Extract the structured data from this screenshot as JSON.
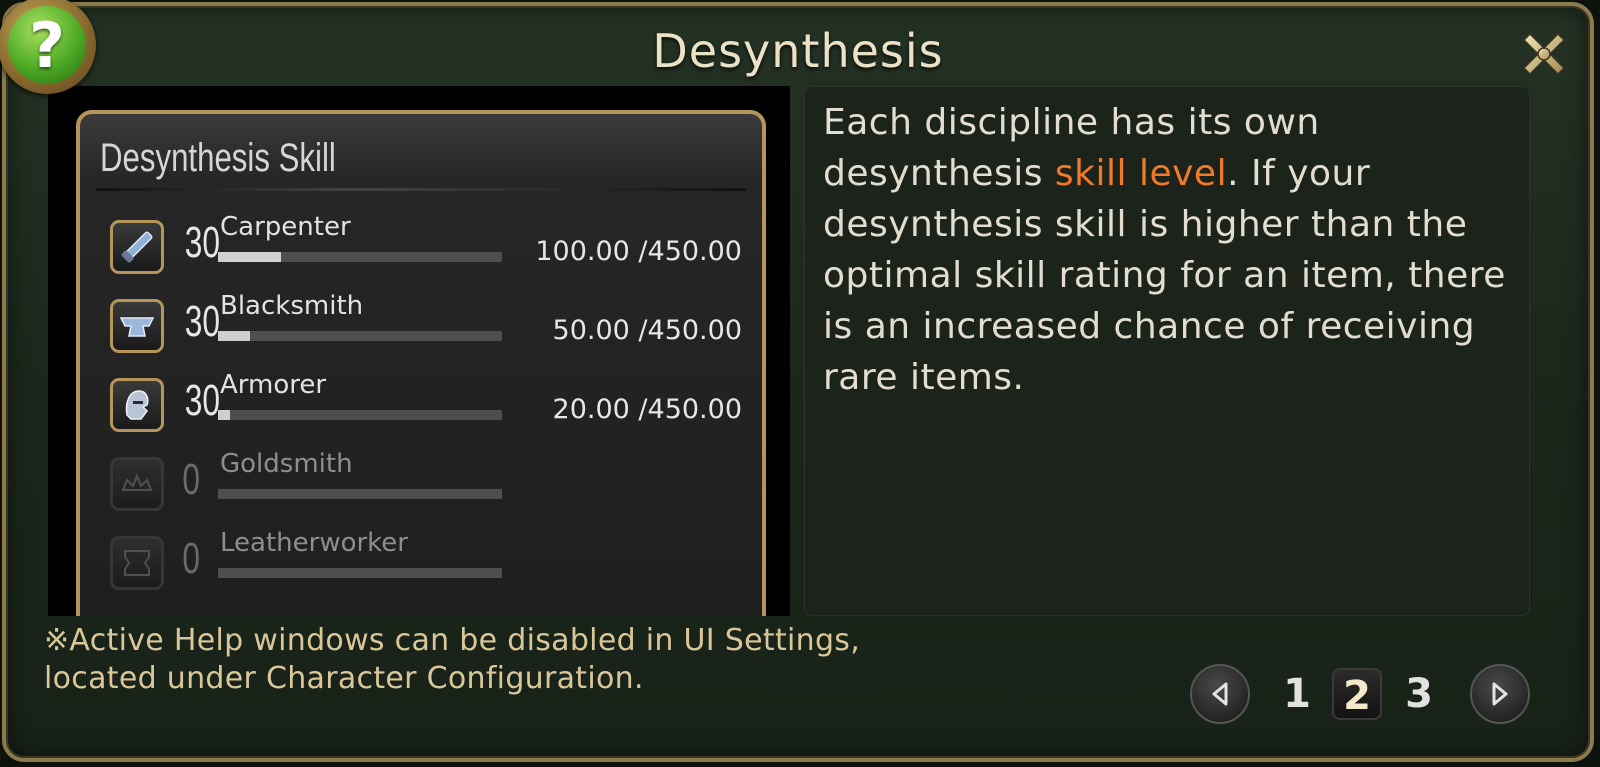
{
  "window": {
    "title": "Desynthesis",
    "help_icon": "question-mark-icon",
    "close_icon": "crossed-swords-close-icon"
  },
  "skill_panel": {
    "header": "Desynthesis Skill",
    "rows": [
      {
        "icon": "saw-icon",
        "level": "30",
        "name": "Carpenter",
        "progress": 0.222,
        "exp": "100.00 /450.00",
        "active": true
      },
      {
        "icon": "anvil-icon",
        "level": "30",
        "name": "Blacksmith",
        "progress": 0.111,
        "exp": "50.00 /450.00",
        "active": true
      },
      {
        "icon": "helmet-icon",
        "level": "30",
        "name": "Armorer",
        "progress": 0.044,
        "exp": "20.00 /450.00",
        "active": true
      },
      {
        "icon": "tiara-icon",
        "level": "0",
        "name": "Goldsmith",
        "progress": 0,
        "exp": "",
        "active": false
      },
      {
        "icon": "leather-icon",
        "level": "0",
        "name": "Leatherworker",
        "progress": 0,
        "exp": "",
        "active": false
      }
    ]
  },
  "description": {
    "part1": "Each discipline has its own desynthesis ",
    "highlight": "skill level",
    "part2": ". If your desynthesis skill is higher than the optimal skill rating for an item, there is an increased chance of receiving rare items."
  },
  "note": {
    "line1": "※Active Help windows can be disabled in UI Settings,",
    "line2": "located under Character Configuration."
  },
  "pager": {
    "pages": [
      "1",
      "2",
      "3"
    ],
    "current": "2",
    "prev_icon": "triangle-left-icon",
    "next_icon": "triangle-right-icon"
  },
  "colors": {
    "highlight": "#ef7a2a",
    "frame": "#8a7a4e",
    "help_badge": "#4caa24"
  }
}
